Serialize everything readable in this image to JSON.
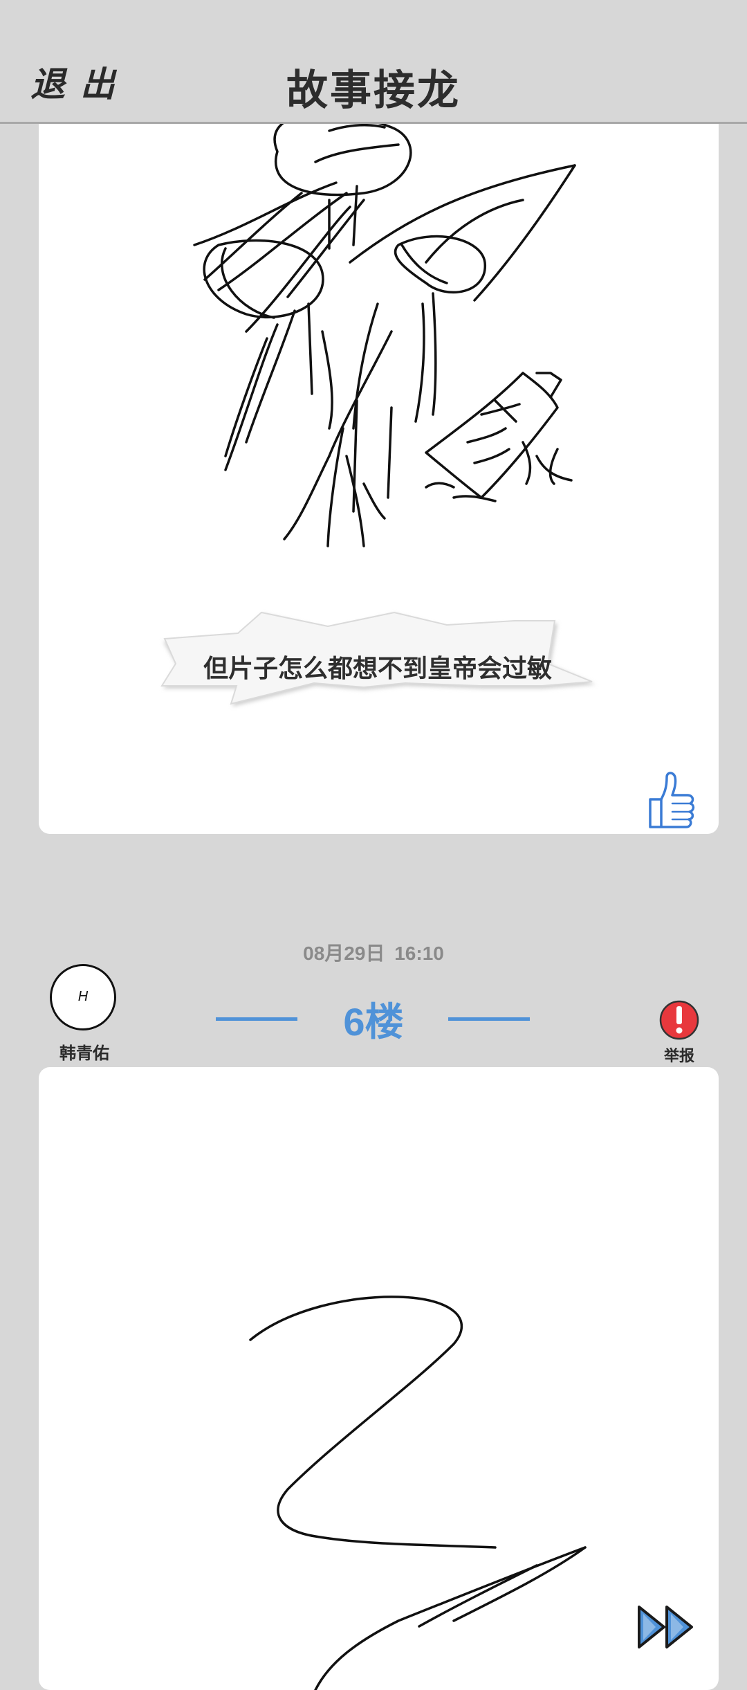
{
  "header": {
    "exit_label": "退出",
    "title": "故事接龙"
  },
  "post1": {
    "caption": "但片子怎么都想不到皇帝会过敏",
    "like_icon": "thumbs-up-icon"
  },
  "post2": {
    "timestamp": "08月29日  16:10",
    "author": {
      "avatar_text": "H",
      "name": "韩青佑"
    },
    "floor": "6楼",
    "report_label": "举报",
    "report_icon": "exclamation-icon"
  },
  "controls": {
    "fast_forward_icon": "fast-forward-icon"
  },
  "colors": {
    "accent": "#4f92d8",
    "report": "#e8383d",
    "background": "#d7d7d7"
  }
}
